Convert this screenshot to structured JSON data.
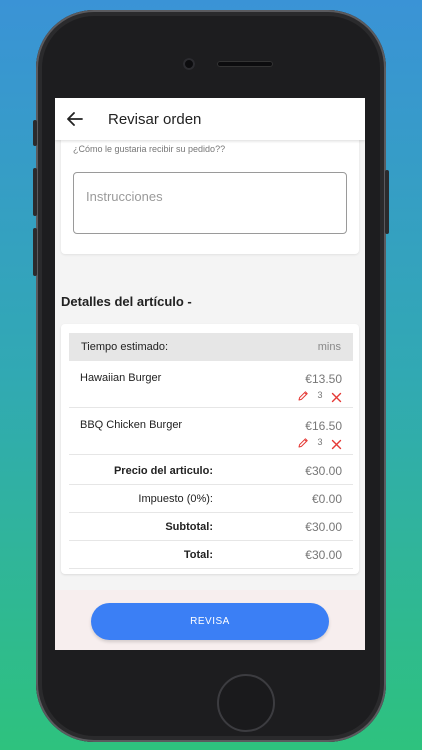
{
  "header": {
    "title": "Revisar orden",
    "back_icon": "arrow-left-icon"
  },
  "delivery": {
    "question": "¿Cómo le gustaria recibir su pedido??",
    "instructions_placeholder": "Instrucciones"
  },
  "details": {
    "title": "Detalles del artículo -",
    "estimated_label": "Tiempo estimado:",
    "estimated_value": "mins",
    "items": [
      {
        "name": "Hawaiian Burger",
        "price": "€13.50",
        "quantity": "3"
      },
      {
        "name": "BBQ Chicken Burger",
        "price": "€16.50",
        "quantity": "3"
      }
    ],
    "totals": [
      {
        "label": "Precio del articulo:",
        "value": "€30.00",
        "bold": true
      },
      {
        "label": "Impuesto (0%):",
        "value": "€0.00",
        "bold": false
      },
      {
        "label": "Subtotal:",
        "value": "€30.00",
        "bold": true
      },
      {
        "label": "Total:",
        "value": "€30.00",
        "bold": true
      }
    ]
  },
  "action": {
    "button_label": "REVISA"
  },
  "colors": {
    "accent": "#3b7ff5",
    "remove": "#e53935",
    "edit": "#e53935",
    "background_top": "#3a93d6",
    "background_bottom": "#2ec27e"
  }
}
